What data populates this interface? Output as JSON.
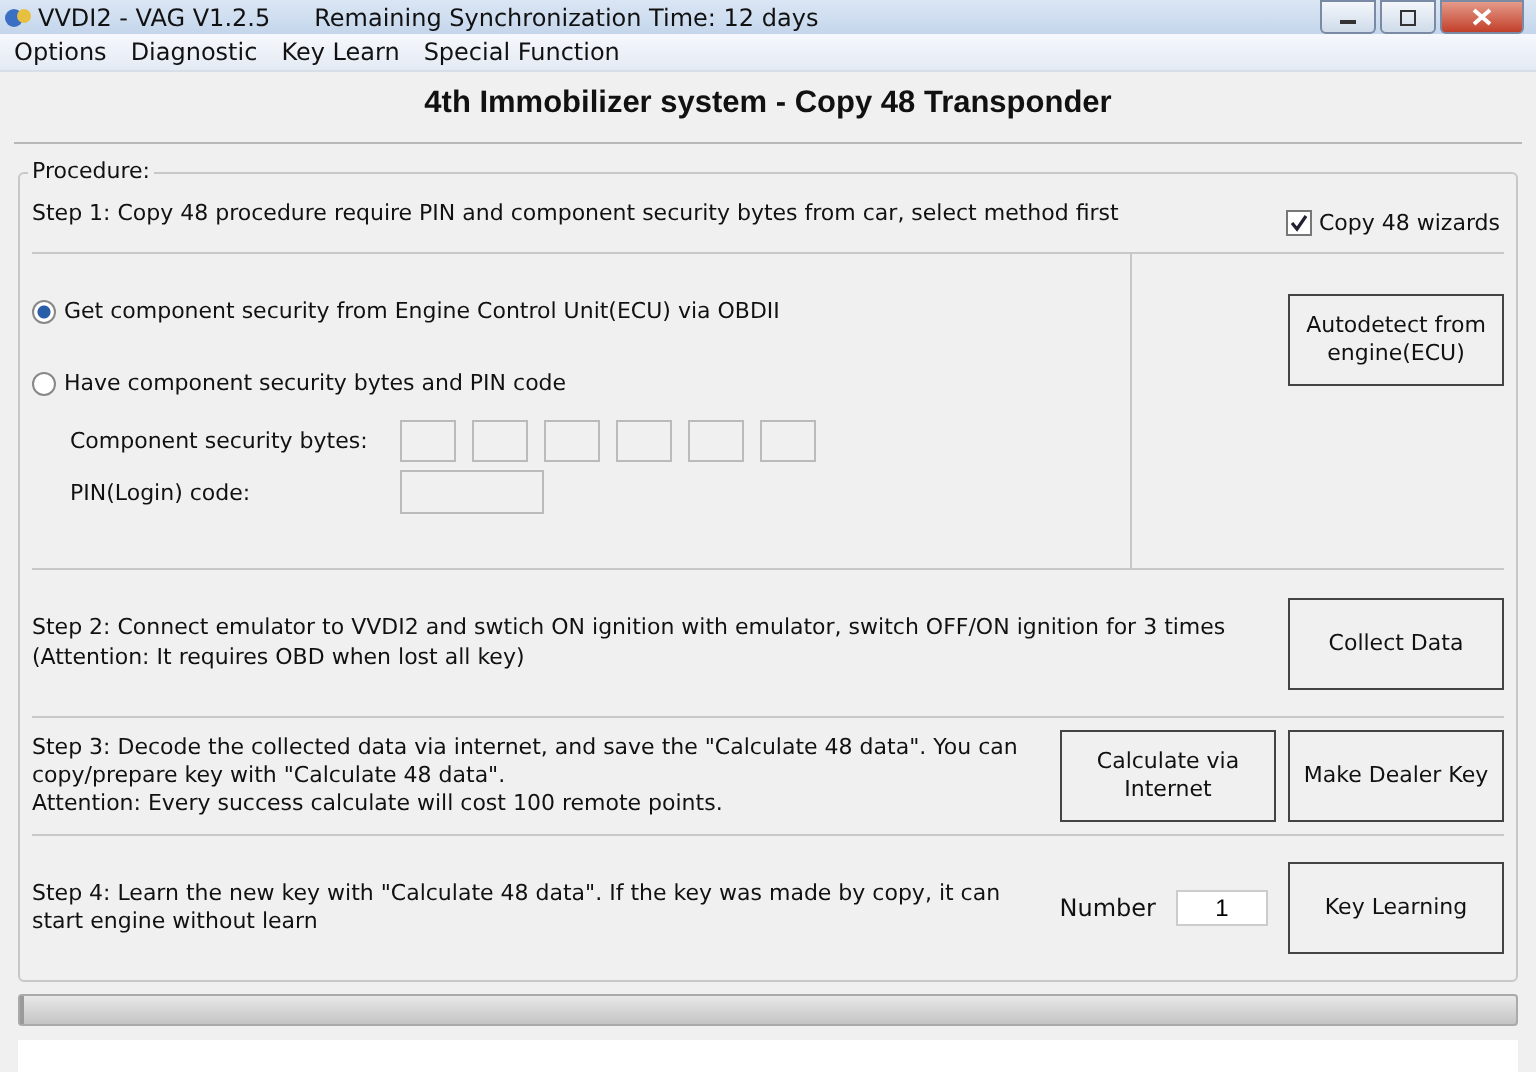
{
  "window": {
    "title": "VVDI2 - VAG V1.2.5",
    "subtitle": "Remaining Synchronization Time: 12 days"
  },
  "menu": [
    "Options",
    "Diagnostic",
    "Key Learn",
    "Special Function"
  ],
  "heading": "4th Immobilizer system - Copy 48 Transponder",
  "procedure": {
    "legend": "Procedure:",
    "step1": {
      "text": "Step 1: Copy 48 procedure require PIN and component security bytes from car, select method first",
      "wizard": {
        "label": "Copy 48 wizards",
        "checked": true
      }
    },
    "methods": [
      {
        "label": "Get component security from Engine Control Unit(ECU) via OBDII",
        "selected": true
      },
      {
        "label": "Have component security bytes and PIN code",
        "selected": false
      }
    ],
    "security_bytes_label": "Component security bytes:",
    "pin_label": "PIN(Login) code:",
    "autodetect_button": "Autodetect from engine(ECU)",
    "step2": {
      "text": "Step 2: Connect emulator to VVDI2 and swtich ON ignition with emulator, switch OFF/ON ignition for 3 times\n(Attention: It requires OBD when lost all key)",
      "button": "Collect Data"
    },
    "step3": {
      "text": "Step 3: Decode the collected data via internet, and save the \"Calculate 48 data\". You can copy/prepare key with \"Calculate 48 data\".\nAttention: Every success calculate will cost 100 remote points.",
      "buttons": [
        "Calculate via Internet",
        "Make Dealer Key"
      ]
    },
    "step4": {
      "text": "Step 4: Learn the new key with \"Calculate 48 data\". If the key was made by copy, it can start engine without learn",
      "number_label": "Number",
      "number": "1",
      "button": "Key Learning"
    }
  },
  "progress_bar": {
    "level": 0
  }
}
